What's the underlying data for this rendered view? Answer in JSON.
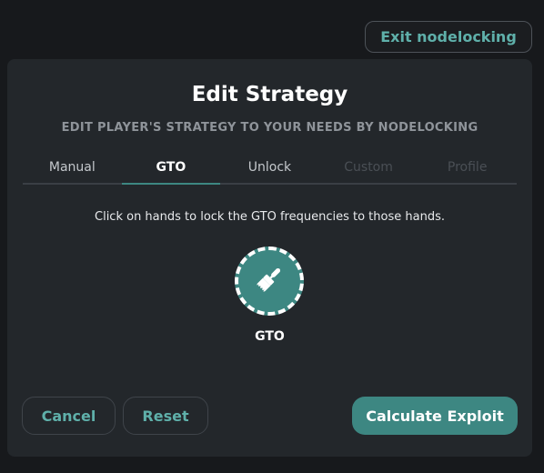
{
  "header": {
    "exit_label": "Exit nodelocking"
  },
  "modal": {
    "title": "Edit Strategy",
    "subtitle": "EDIT PLAYER'S STRATEGY TO YOUR NEEDS BY NODELOCKING",
    "tabs": [
      {
        "label": "Manual",
        "state": "normal"
      },
      {
        "label": "GTO",
        "state": "active"
      },
      {
        "label": "Unlock",
        "state": "normal"
      },
      {
        "label": "Custom",
        "state": "disabled"
      },
      {
        "label": "Profile",
        "state": "disabled"
      }
    ],
    "instruction": "Click on hands to lock the GTO frequencies to those hands.",
    "tool": {
      "icon": "paintbrush-icon",
      "label": "GTO"
    },
    "buttons": {
      "cancel": "Cancel",
      "reset": "Reset",
      "calculate": "Calculate Exploit"
    }
  },
  "colors": {
    "accent": "#3d8782",
    "accent_text": "#5fb0aa",
    "background": "#17191c",
    "panel": "#23272b"
  }
}
